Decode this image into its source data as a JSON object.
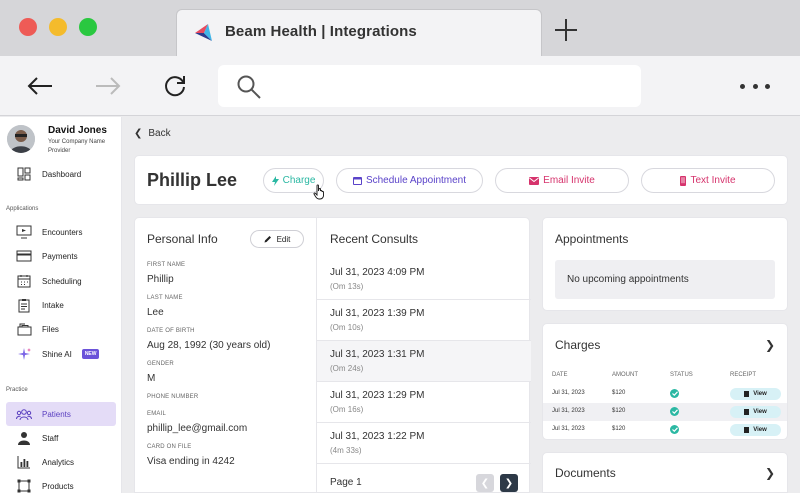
{
  "browser": {
    "tab_title": "Beam Health | Integrations"
  },
  "profile": {
    "name": "David Jones",
    "subtitle": "Your Company Name Provider"
  },
  "sidebar": {
    "dashboard": "Dashboard",
    "section_applications": "Applications",
    "section_practice": "Practice",
    "items": [
      {
        "label": "Encounters",
        "icon": "monitor-icon"
      },
      {
        "label": "Payments",
        "icon": "card-icon"
      },
      {
        "label": "Scheduling",
        "icon": "calendar-icon"
      },
      {
        "label": "Intake",
        "icon": "clipboard-icon"
      },
      {
        "label": "Files",
        "icon": "folder-icon"
      },
      {
        "label": "Shine AI",
        "icon": "sparkle-icon",
        "badge": "NEW"
      }
    ],
    "practice_items": [
      {
        "label": "Patients",
        "icon": "people-icon",
        "active": true
      },
      {
        "label": "Staff",
        "icon": "staff-icon"
      },
      {
        "label": "Analytics",
        "icon": "chart-icon"
      },
      {
        "label": "Products",
        "icon": "box-icon"
      }
    ]
  },
  "main": {
    "back_label": "Back",
    "patient_name": "Phillip Lee",
    "actions": {
      "charge": "Charge",
      "schedule": "Schedule Appointment",
      "email": "Email Invite",
      "text": "Text Invite"
    },
    "personal_info": {
      "title": "Personal Info",
      "edit_label": "Edit",
      "fields": [
        {
          "label": "FIRST NAME",
          "value": "Phillip"
        },
        {
          "label": "LAST NAME",
          "value": "Lee"
        },
        {
          "label": "DATE OF BIRTH",
          "value": "Aug 28, 1992 (30 years old)"
        },
        {
          "label": "GENDER",
          "value": "M"
        },
        {
          "label": "PHONE NUMBER",
          "value": ""
        },
        {
          "label": "EMAIL",
          "value": "phillip_lee@gmail.com"
        },
        {
          "label": "CARD ON FILE",
          "value": "Visa ending in 4242"
        }
      ]
    },
    "recent_consults": {
      "title": "Recent Consults",
      "rows": [
        {
          "date": "Jul 31, 2023 4:09 PM",
          "duration": "(Om 13s)"
        },
        {
          "date": "Jul 31, 2023 1:39 PM",
          "duration": "(Om 10s)"
        },
        {
          "date": "Jul 31, 2023 1:31 PM",
          "duration": "(Om 24s)"
        },
        {
          "date": "Jul 31, 2023 1:29 PM",
          "duration": "(Om 16s)"
        },
        {
          "date": "Jul 31, 2023 1:22 PM",
          "duration": "(4m 33s)"
        }
      ],
      "page_label": "Page 1"
    },
    "appointments": {
      "title": "Appointments",
      "empty_text": "No upcoming appointments"
    },
    "charges": {
      "title": "Charges",
      "headers": [
        "DATE",
        "AMOUNT",
        "STATUS",
        "RECEIPT"
      ],
      "rows": [
        {
          "date": "Jul 31, 2023",
          "amount": "$120",
          "view": "View"
        },
        {
          "date": "Jul 31, 2023",
          "amount": "$120",
          "view": "View"
        },
        {
          "date": "Jul 31, 2023",
          "amount": "$120",
          "view": "View"
        }
      ]
    },
    "documents": {
      "title": "Documents"
    }
  },
  "colors": {
    "accent": "#5a43c9",
    "teal": "#2bb8a3",
    "pink": "#d6336c",
    "active_bg": "#e4dcf7"
  }
}
